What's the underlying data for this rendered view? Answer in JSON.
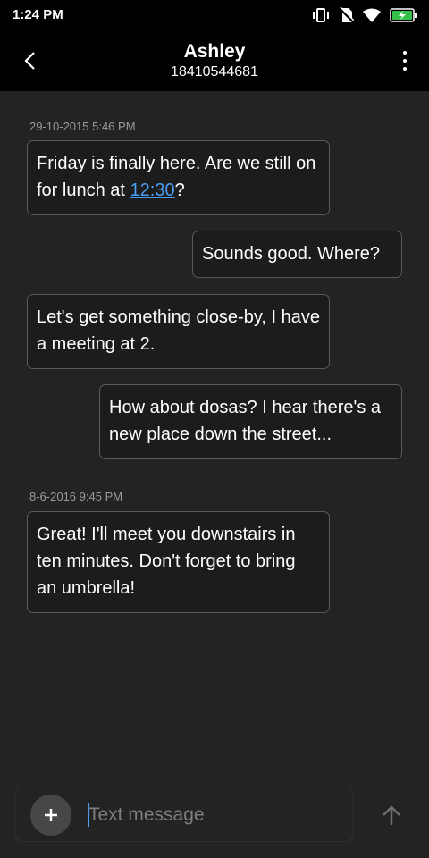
{
  "status_bar": {
    "time": "1:24 PM",
    "icons": [
      "vibrate-icon",
      "no-sim-icon",
      "wifi-icon",
      "battery-charging-icon"
    ]
  },
  "header": {
    "contact_name": "Ashley",
    "contact_number": "18410544681",
    "back_icon": "chevron-left-icon",
    "more_icon": "more-vertical-icon"
  },
  "conversation": {
    "groups": [
      {
        "timestamp": "29-10-2015 5:46 PM",
        "messages": [
          {
            "direction": "incoming",
            "text_before": "Friday is finally here. Are we still on for lunch at ",
            "link": "12:30",
            "text_after": "?"
          },
          {
            "direction": "outgoing",
            "text": "Sounds good. Where?"
          },
          {
            "direction": "incoming",
            "text": "Let's get something close-by, I have a meeting at 2."
          },
          {
            "direction": "outgoing",
            "text": "How about dosas? I hear there's a new place down the street..."
          }
        ]
      },
      {
        "timestamp": "8-6-2016 9:45 PM",
        "messages": [
          {
            "direction": "incoming",
            "text": "Great! I'll meet you downstairs in ten minutes. Don't forget to bring an umbrella!"
          }
        ]
      }
    ]
  },
  "composer": {
    "placeholder": "Text message",
    "value": "",
    "attach_icon": "plus-icon",
    "send_icon": "arrow-up-icon"
  },
  "colors": {
    "background": "#232323",
    "bars": "#000000",
    "bubble_border": "#5a5a5a",
    "link": "#4a9df0",
    "timestamp": "#9a9a9a"
  }
}
